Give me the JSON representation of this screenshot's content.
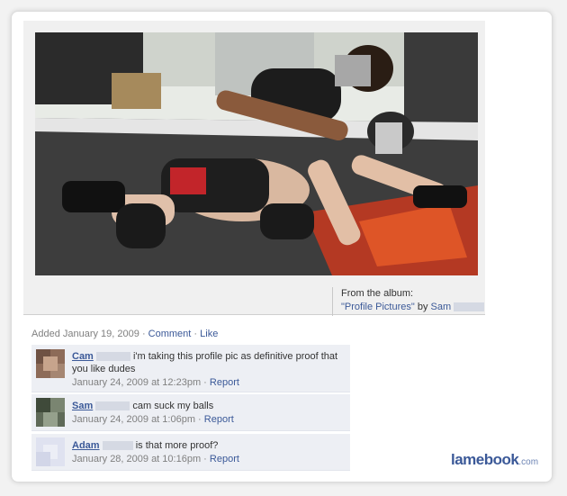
{
  "album": {
    "from_label": "From the album:",
    "album_link": "\"Profile Pictures\"",
    "by_label": "by",
    "owner_name": "Sam"
  },
  "post": {
    "added_text": "Added January 19, 2009",
    "comment_link": "Comment",
    "like_link": "Like"
  },
  "comments": [
    {
      "name": "Cam",
      "text": "i'm taking this profile pic as definitive proof that you like dudes",
      "timestamp": "January 24, 2009 at 12:23pm",
      "report_label": "Report",
      "avatar_color": "#7a5a4a"
    },
    {
      "name": "Sam",
      "text": "cam suck my balls",
      "timestamp": "January 24, 2009 at 1:06pm",
      "report_label": "Report",
      "avatar_color": "#5b6b4a"
    },
    {
      "name": "Adam",
      "text": "is that more proof?",
      "timestamp": "January 28, 2009 at 10:16pm",
      "report_label": "Report",
      "avatar_color": "#dcdff0"
    }
  ],
  "watermark": {
    "brand": "lamebook",
    "tld": ".com"
  },
  "colors": {
    "link": "#3b5998",
    "comment_bg": "#edeff4",
    "meta_gray": "#808080"
  }
}
